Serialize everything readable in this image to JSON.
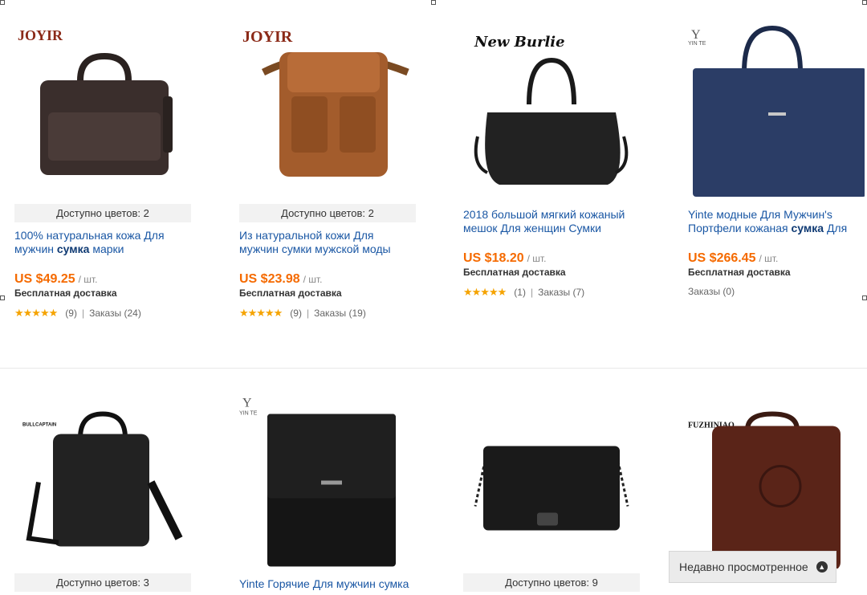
{
  "products_row1": [
    {
      "brand": "JOYIR",
      "colors_available": "Доступно цветов: 2",
      "title_before": "100% натуральная кожа Для мужчин ",
      "title_bold": "сумка",
      "title_after": " марки",
      "price": "US $49.25",
      "unit": "/ шт.",
      "shipping": "Бесплатная доставка",
      "rating_stars": "★★★★★",
      "reviews": "(9)",
      "orders": "Заказы (24)"
    },
    {
      "brand": "JOYIR",
      "colors_available": "Доступно цветов: 2",
      "title_before": "Из натуральной кожи Для мужчин сумки мужской моды сумка Для",
      "title_bold": "",
      "title_after": "",
      "price": "US $23.98",
      "unit": "/ шт.",
      "shipping": "Бесплатная доставка",
      "rating_stars": "★★★★★",
      "reviews": "(9)",
      "orders": "Заказы (19)"
    },
    {
      "brand": "New Burlie",
      "colors_available": "",
      "title_before": "2018 большой мягкий кожаный мешок Для женщин Сумки",
      "title_bold": "",
      "title_after": "",
      "price": "US $18.20",
      "unit": "/ шт.",
      "shipping": "Бесплатная доставка",
      "rating_stars": "★★★★★",
      "reviews": "(1)",
      "orders": "Заказы (7)"
    },
    {
      "brand": "Y YIN TE",
      "colors_available": "",
      "title_before": "Yinte модные Для Мужчин's Портфели кожаная ",
      "title_bold": "сумка",
      "title_after": " Для",
      "price": "US $266.45",
      "unit": "/ шт.",
      "shipping": "Бесплатная доставка",
      "rating_stars": "",
      "reviews": "",
      "orders": "Заказы (0)"
    }
  ],
  "products_row2": [
    {
      "brand": "BULLCAPTAIN",
      "colors_available": "Доступно цветов: 3",
      "title": ""
    },
    {
      "brand": "Y YIN TE",
      "colors_available": "",
      "title": "Yinte Горячие Для мужчин сумка"
    },
    {
      "brand": "",
      "colors_available": "Доступно цветов: 9",
      "title": ""
    },
    {
      "brand": "FUZHINIAO",
      "colors_available": "",
      "title": ""
    }
  ],
  "recently_viewed": {
    "label": "Недавно просмотренное"
  },
  "colors": {
    "price": "#f56a00",
    "title_link": "#1a57a4",
    "star": "#f5a300"
  }
}
